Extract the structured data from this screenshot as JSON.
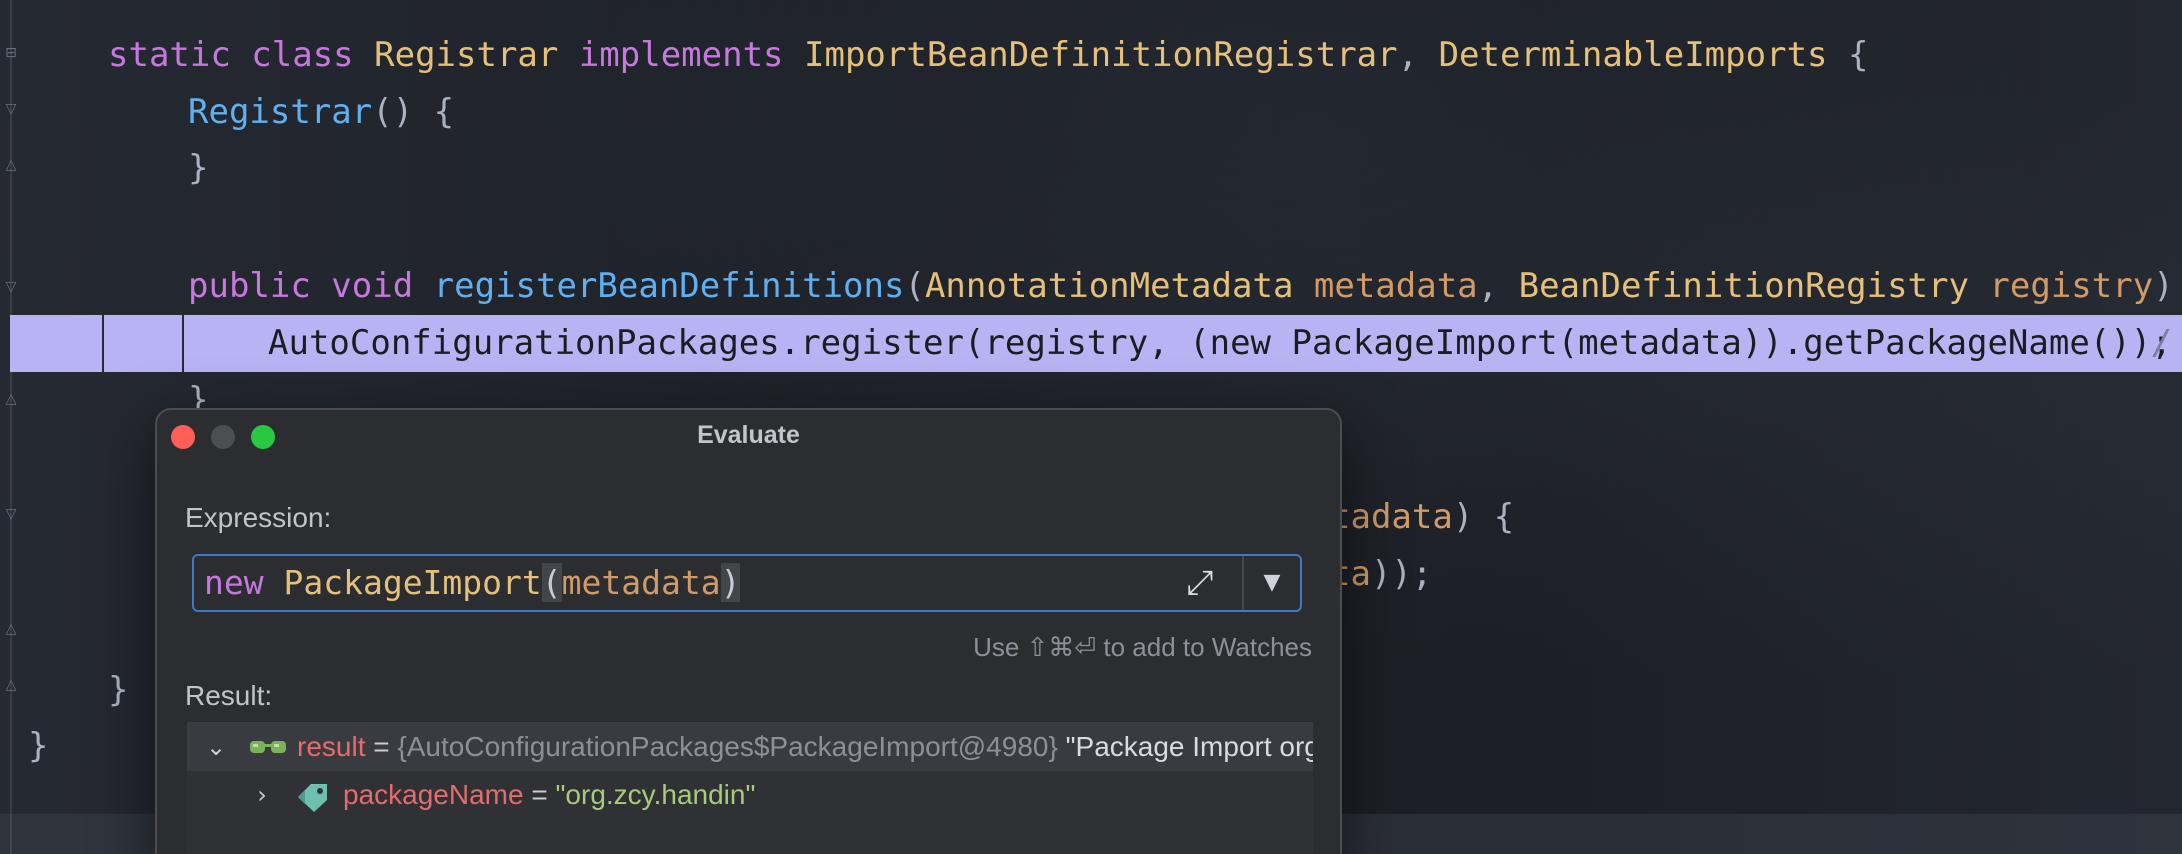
{
  "editor": {
    "lines": [
      {
        "parts": [
          [
            "kw",
            "static "
          ],
          [
            "kw",
            "class "
          ],
          [
            "type",
            "Registrar "
          ],
          [
            "kw",
            "implements "
          ],
          [
            "type",
            "ImportBeanDefinitionRegistrar"
          ],
          [
            "punc",
            ", "
          ],
          [
            "type",
            "DeterminableImports "
          ],
          [
            "punc",
            "{"
          ]
        ]
      },
      {
        "parts": [
          [
            "fn",
            "Registrar"
          ],
          [
            "punc",
            "() {"
          ]
        ]
      },
      {
        "parts": [
          [
            "punc",
            "}"
          ]
        ]
      },
      {
        "parts": [
          [
            "kw",
            "public "
          ],
          [
            "kw",
            "void "
          ],
          [
            "fn",
            "registerBeanDefinitions"
          ],
          [
            "punc",
            "("
          ],
          [
            "type",
            "AnnotationMetadata "
          ],
          [
            "param",
            "metadata"
          ],
          [
            "punc",
            ", "
          ],
          [
            "type",
            "BeanDefinitionRegistry "
          ],
          [
            "param",
            "registry"
          ],
          [
            "punc",
            ") {"
          ]
        ]
      },
      {
        "parts": [
          [
            "hl",
            "AutoConfigurationPackages.register(registry, (new PackageImport(metadata)).getPackageName());"
          ]
        ]
      },
      {
        "parts": [
          [
            "punc",
            "}"
          ]
        ]
      },
      {
        "parts": [
          [
            "param",
            "tadata"
          ],
          [
            "punc",
            ") {"
          ]
        ]
      },
      {
        "parts": [
          [
            "param",
            "ta"
          ],
          [
            "punc",
            "));"
          ]
        ]
      },
      {
        "parts": [
          [
            "punc",
            "}"
          ]
        ]
      },
      {
        "parts": [
          [
            "punc",
            "}"
          ]
        ]
      }
    ],
    "hl_trailing": "/"
  },
  "dialog": {
    "title": "Evaluate",
    "expression_label": "Expression:",
    "expression": {
      "kw": "new ",
      "type": "PackageImport",
      "open": "(",
      "arg": "metadata",
      "close": ")"
    },
    "watch_hint": "Use ⇧⌘⏎ to add to Watches",
    "result_label": "Result:",
    "result_rows": [
      {
        "name": "result",
        "eq": " = ",
        "ref": "{AutoConfigurationPackages$PackageImport@4980}",
        "value": " \"Package Import org.zcy.handin\"",
        "icon": "watch-glasses-icon",
        "expanded": true
      },
      {
        "name": "packageName",
        "eq": " = ",
        "value": "\"org.zcy.handin\"",
        "icon": "field-tag-icon",
        "expanded": false
      }
    ]
  },
  "colors": {
    "keyword": "#c678dd",
    "type": "#e5c07b",
    "function": "#61afef",
    "param": "#d19a66",
    "highlight_row": "#b8b4f4",
    "focus_border": "#3d79c8"
  }
}
